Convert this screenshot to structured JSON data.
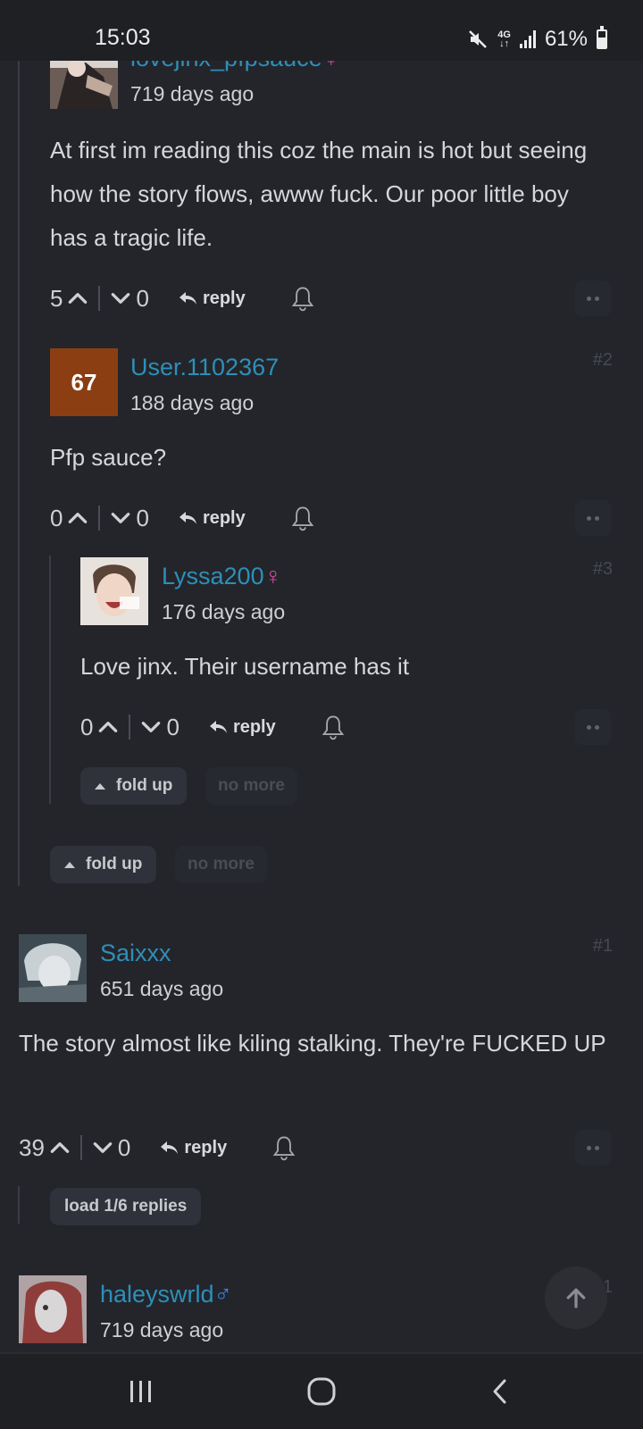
{
  "status_bar": {
    "time": "15:03",
    "network": "4G",
    "battery": "61%"
  },
  "comments": [
    {
      "username": "lovejinx_pfpsauce",
      "gender_symbol": "♀",
      "time_ago": "719 days ago",
      "body": "At first im reading this coz the main is hot but seeing how the story flows, awww fuck. Our poor little boy has a tragic life.",
      "upvotes": "5",
      "downvotes": "0",
      "reply_label": "reply"
    },
    {
      "username": "User.1102367",
      "avatar_text": "67",
      "index": "#2",
      "time_ago": "188 days ago",
      "body": "Pfp sauce?",
      "upvotes": "0",
      "downvotes": "0",
      "reply_label": "reply"
    },
    {
      "username": "Lyssa200",
      "gender_symbol": "♀",
      "index": "#3",
      "time_ago": "176 days ago",
      "body": "Love jinx. Their username has it",
      "upvotes": "0",
      "downvotes": "0",
      "reply_label": "reply"
    },
    {
      "username": "Saixxx",
      "index": "#1",
      "time_ago": "651 days ago",
      "body": "The story almost like kiling stalking. They're FUCKED UP",
      "upvotes": "39",
      "downvotes": "0",
      "reply_label": "reply"
    },
    {
      "username": "haleyswrld",
      "gender_symbol": "♂",
      "index": "#1",
      "time_ago": "719 days ago"
    }
  ],
  "thread_controls": {
    "fold_up": "fold up",
    "no_more": "no more",
    "load_replies": "load 1/6 replies"
  },
  "colors": {
    "background": "#23252b",
    "username": "#2e8fb8",
    "female": "#d74e9b",
    "male": "#3c85e8",
    "avatar_67": "#8b3e12"
  }
}
